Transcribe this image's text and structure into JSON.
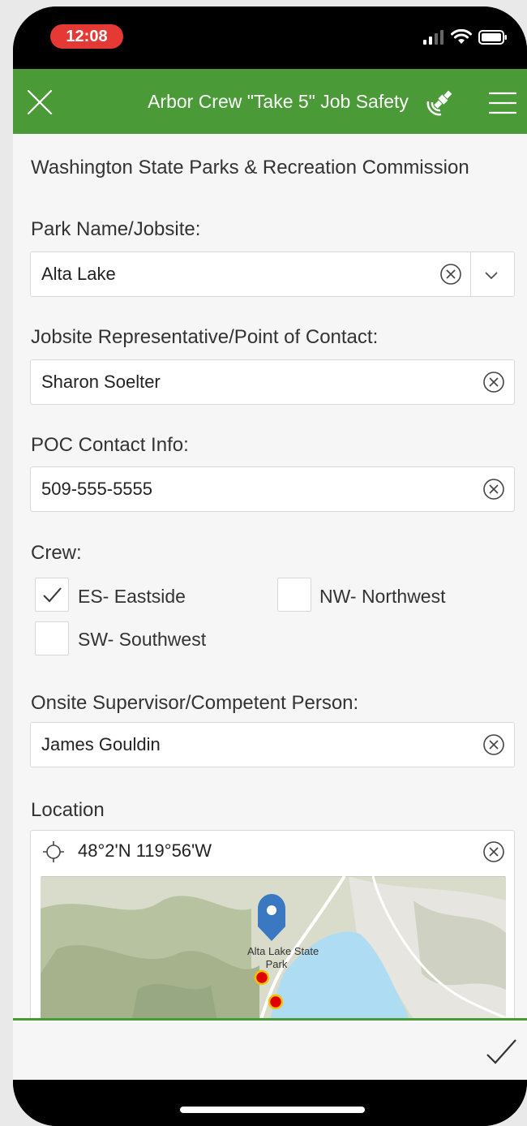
{
  "status_bar": {
    "time": "12:08"
  },
  "app_bar": {
    "title": "Arbor Crew \"Take 5\" Job Safety"
  },
  "form": {
    "organization": "Washington State Parks & Recreation Commission",
    "park": {
      "label": "Park Name/Jobsite:",
      "value": "Alta Lake"
    },
    "poc": {
      "label": "Jobsite Representative/Point of Contact:",
      "value": "Sharon Soelter"
    },
    "poc_info": {
      "label": "POC Contact Info:",
      "value": "509-555-5555"
    },
    "crew": {
      "label": "Crew:",
      "options": [
        {
          "label": "ES- Eastside",
          "checked": true
        },
        {
          "label": "NW- Northwest",
          "checked": false
        },
        {
          "label": "SW- Southwest",
          "checked": false
        }
      ]
    },
    "supervisor": {
      "label": "Onsite Supervisor/Competent Person:",
      "value": "James Gouldin"
    },
    "location": {
      "label": "Location",
      "value": "48°2'N 119°56'W",
      "map_label_line1": "Alta Lake State",
      "map_label_line2": "Park"
    }
  },
  "colors": {
    "app_bar": "#4a9a38",
    "status_time_pill": "#e53935",
    "map_water": "#aedcf2",
    "map_pin": "#3a78c2",
    "map_poi": "#e00000"
  },
  "icons": [
    "close-icon",
    "gps-satellite-icon",
    "menu-icon",
    "clear-icon",
    "chevron-down-icon",
    "checkmark-icon",
    "crosshair-icon",
    "map-pin-icon",
    "submit-check-icon"
  ]
}
